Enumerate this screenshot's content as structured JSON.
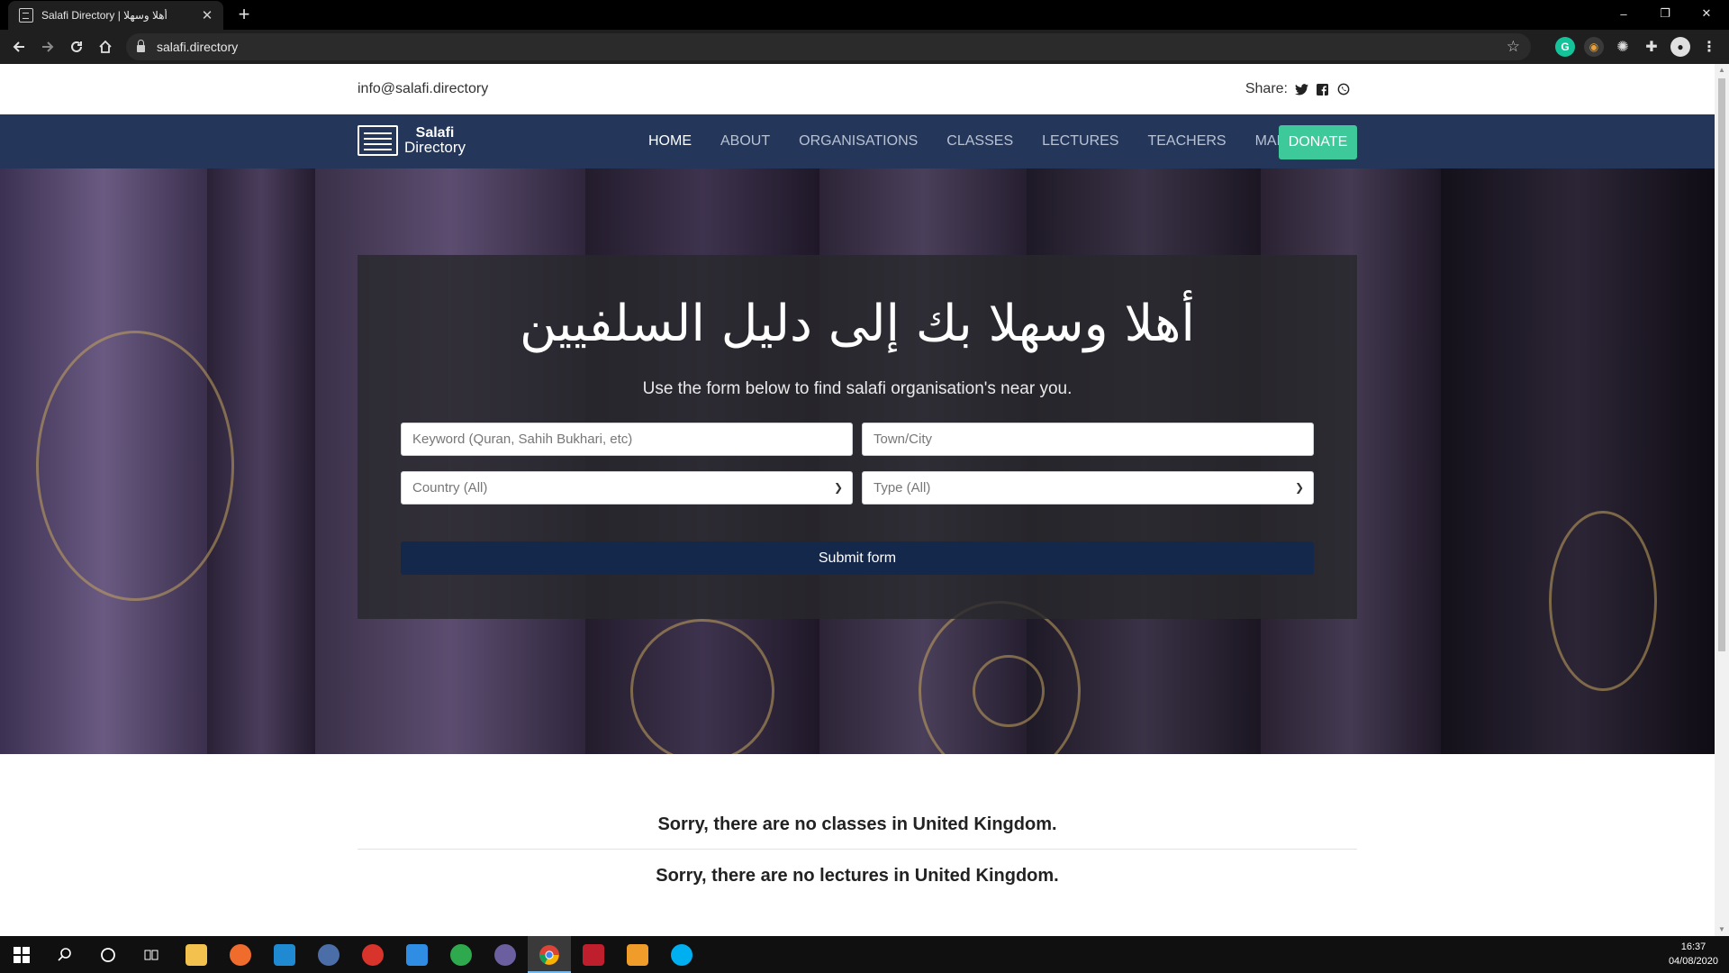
{
  "browser": {
    "tab_title": "Salafi Directory | أهلا وسهلا",
    "tab_close": "✕",
    "new_tab": "+",
    "url": "salafi.directory",
    "window_controls": [
      "–",
      "❐",
      "✕"
    ],
    "extensions": [
      "grammarly-icon",
      "color-picker-icon",
      "react-devtools-icon",
      "puzzle-icon",
      "account-icon",
      "menu-icon"
    ]
  },
  "page": {
    "topbar": {
      "email": "info@salafi.directory",
      "share_label": "Share:"
    },
    "brand": {
      "line1": "Salafi",
      "line2": "Directory"
    },
    "nav": {
      "items": [
        "HOME",
        "ABOUT",
        "ORGANISATIONS",
        "CLASSES",
        "LECTURES",
        "TEACHERS",
        "MAPS"
      ],
      "active": "HOME",
      "donate": "DONATE"
    },
    "hero": {
      "title": "أهلا وسهلا بك إلى دليل السلفيين",
      "subtitle": "Use the form below to find salafi organisation's near you.",
      "keyword_placeholder": "Keyword (Quran, Sahih Bukhari, etc)",
      "town_placeholder": "Town/City",
      "country_selected": "Country (All)",
      "type_selected": "Type (All)",
      "submit": "Submit form"
    },
    "messages": {
      "classes": "Sorry, there are no classes in United Kingdom.",
      "lectures": "Sorry, there are no lectures in United Kingdom."
    },
    "colors": {
      "navbar": "#24375a",
      "donate": "#3ec99a",
      "submit": "#14284b"
    }
  },
  "taskbar": {
    "time": "16:37",
    "date": "04/08/2020"
  }
}
